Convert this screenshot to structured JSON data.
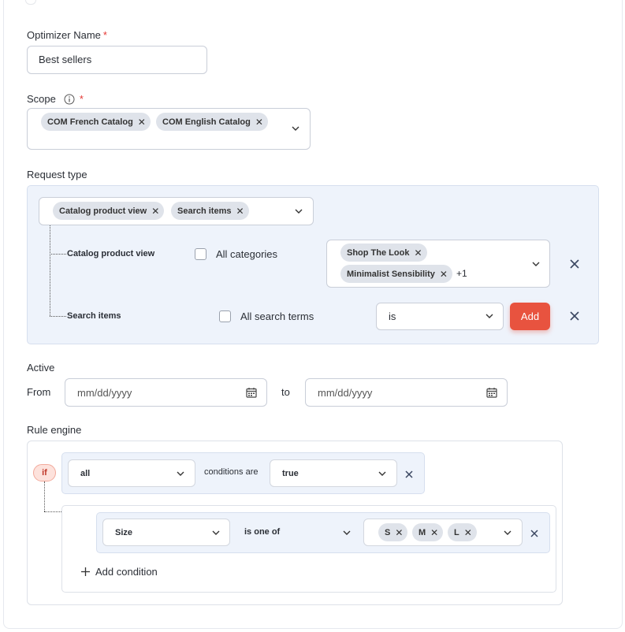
{
  "optimizer_name": {
    "label": "Optimizer Name",
    "required_mark": "*",
    "value": "Best sellers"
  },
  "scope": {
    "label": "Scope",
    "info_icon": "info-icon",
    "required_mark": "*",
    "chips": [
      "COM French Catalog",
      "COM English Catalog"
    ]
  },
  "request_type": {
    "label": "Request type",
    "chips": [
      "Catalog product view",
      "Search items"
    ],
    "rows": {
      "catalog": {
        "name": "Catalog product view",
        "checkbox_label": "All categories",
        "chips": [
          "Shop The Look",
          "Minimalist Sensibility"
        ],
        "more": "+1"
      },
      "search": {
        "name": "Search items",
        "checkbox_label": "All search terms",
        "operator": "is",
        "add_label": "Add"
      }
    }
  },
  "active": {
    "label": "Active",
    "from_label": "From",
    "to_label": "to",
    "from_placeholder": "mm/dd/yyyy",
    "to_placeholder": "mm/dd/yyyy"
  },
  "rule_engine": {
    "label": "Rule engine",
    "if_label": "if",
    "aggregator": "all",
    "conditions_are": "conditions are",
    "truth_value": "true",
    "condition": {
      "attribute": "Size",
      "operator": "is one of",
      "values": [
        "S",
        "M",
        "L"
      ]
    },
    "add_condition": "Add condition"
  },
  "colors": {
    "primary": "#e8533f",
    "required": "#e53935",
    "request_bg": "#eef3fb",
    "chip_bg": "#dfe3ea"
  }
}
